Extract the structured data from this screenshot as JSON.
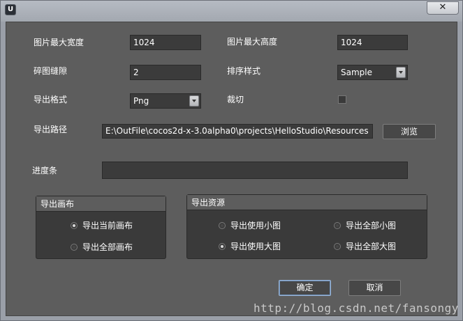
{
  "window": {
    "icon_glyph": "U",
    "close_glyph": "✕"
  },
  "form": {
    "max_width_label": "图片最大宽度",
    "max_width_value": "1024",
    "max_height_label": "图片最大高度",
    "max_height_value": "1024",
    "gap_label": "碎图缝隙",
    "gap_value": "2",
    "sort_label": "排序样式",
    "sort_value": "Sample",
    "format_label": "导出格式",
    "format_value": "Png",
    "trim_label": "裁切",
    "trim_checked": false,
    "path_label": "导出路径",
    "path_value": "E:\\OutFile\\cocos2d-x-3.0alpha0\\projects\\HelloStudio\\Resources",
    "browse_label": "浏览",
    "progress_label": "进度条",
    "progress_value": 0
  },
  "canvas_group": {
    "title": "导出画布",
    "options": [
      {
        "label": "导出当前画布",
        "checked": true
      },
      {
        "label": "导出全部画布",
        "checked": false
      }
    ]
  },
  "resource_group": {
    "title": "导出资源",
    "options": [
      {
        "label": "导出使用小图",
        "checked": false
      },
      {
        "label": "导出全部小图",
        "checked": false
      },
      {
        "label": "导出使用大图",
        "checked": true
      },
      {
        "label": "导出全部大图",
        "checked": false
      }
    ]
  },
  "buttons": {
    "ok": "确定",
    "cancel": "取消"
  },
  "watermark": "http://blog.csdn.net/fansongy",
  "colors": {
    "panel": "#5d5d5d",
    "field": "#3b3b3b",
    "text": "#ffffff",
    "focus_border": "#9ab6d8"
  }
}
